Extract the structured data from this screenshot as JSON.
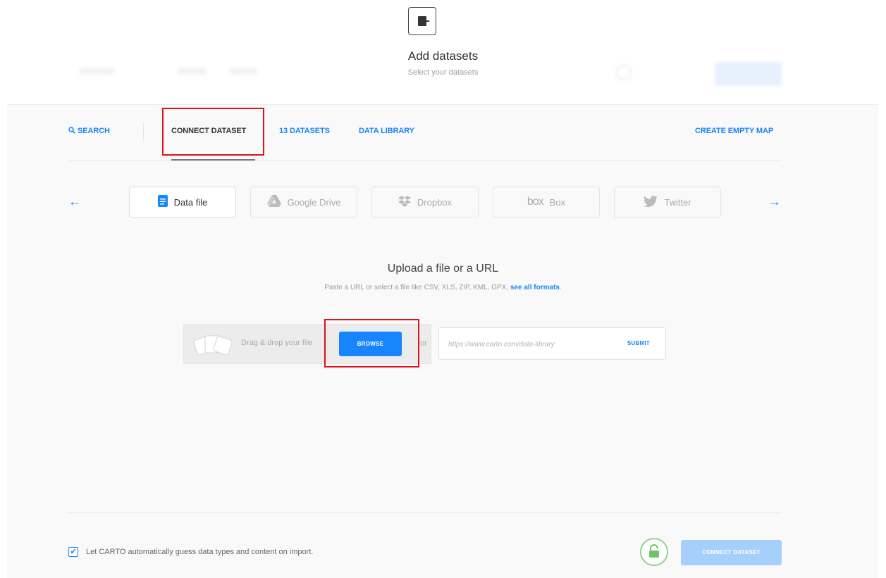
{
  "header": {
    "title": "Add datasets",
    "subtitle": "Select your datasets"
  },
  "nav": {
    "search_label": "SEARCH",
    "connect_label": "CONNECT DATASET",
    "datasets_label": "13 DATASETS",
    "library_label": "DATA LIBRARY",
    "create_empty_label": "CREATE EMPTY MAP"
  },
  "sources": [
    {
      "label": "Data file",
      "icon": "document-icon"
    },
    {
      "label": "Google Drive",
      "icon": "google-drive-icon"
    },
    {
      "label": "Dropbox",
      "icon": "dropbox-icon"
    },
    {
      "label": "Box",
      "icon": "box-logo-icon"
    },
    {
      "label": "Twitter",
      "icon": "twitter-icon"
    }
  ],
  "box_logo_text": "box",
  "arrows": {
    "prev": "←",
    "next": "→"
  },
  "upload": {
    "title": "Upload a file or a URL",
    "subtitle": "Paste a URL or select a file like CSV, XLS, ZIP, KML, GPX,",
    "formats_link": "see all formats",
    "drop_text": "Drag & drop your file",
    "browse_label": "BROWSE",
    "or_text": "or",
    "url_placeholder": "https://www.carto.com/data-library",
    "submit_label": "SUBMIT"
  },
  "footer": {
    "guess_label": "Let CARTO automatically guess data types and content on import.",
    "guess_checked": true,
    "connect_button_label": "CONNECT DATASET"
  },
  "colors": {
    "accent": "#1785fb",
    "highlight": "#e0111b",
    "lock_green": "#8fd38a",
    "disabled_button": "#a6d0fb"
  }
}
